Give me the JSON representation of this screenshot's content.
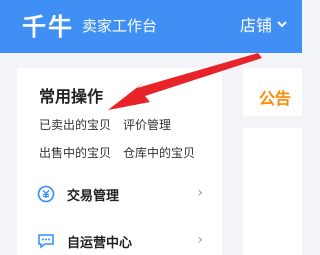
{
  "header": {
    "logo": "千牛",
    "subtitle": "卖家工作台",
    "store_label": "店铺",
    "store_icon": "chevron-down-icon"
  },
  "main": {
    "section_title": "常用操作",
    "quick_links": [
      "已卖出的宝贝",
      "评价管理",
      "出售中的宝贝",
      "仓库中的宝贝"
    ],
    "menu": [
      {
        "label": "交易管理",
        "icon": "transaction-icon"
      },
      {
        "label": "自运营中心",
        "icon": "chat-icon"
      }
    ]
  },
  "side": {
    "notice_title": "公告"
  },
  "colors": {
    "header_bg": "#3f8ff5",
    "accent_orange": "#ff8a00",
    "annotation_red": "#e8232a",
    "icon_blue": "#2f8cff"
  }
}
